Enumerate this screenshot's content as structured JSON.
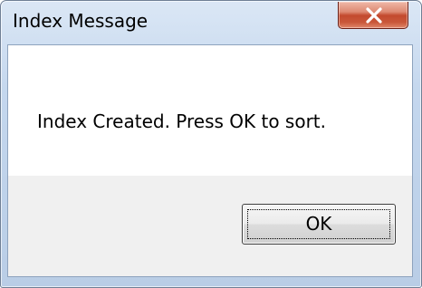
{
  "window": {
    "title": "Index Message"
  },
  "message": {
    "text": "Index Created.  Press OK to sort."
  },
  "buttons": {
    "ok_label": "OK"
  },
  "icons": {
    "close": "close-icon"
  },
  "colors": {
    "close_button": "#c34a2e",
    "frame": "#c4d7ee",
    "message_background": "#ffffff",
    "button_area": "#f0f0f0"
  }
}
